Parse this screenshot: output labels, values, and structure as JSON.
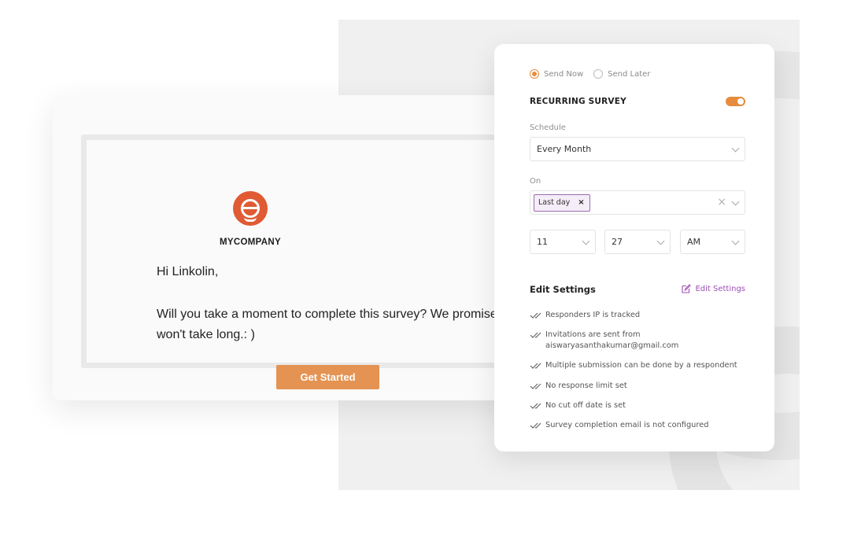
{
  "email": {
    "company": "MYCOMPANY",
    "greeting": "Hi Linkolin,",
    "message": "Will you take a moment to complete this survey? We promise it won't take long.: )",
    "cta_label": "Get Started"
  },
  "settings": {
    "send_options": [
      {
        "label": "Send Now",
        "selected": true
      },
      {
        "label": "Send Later",
        "selected": false
      }
    ],
    "recurring_title": "RECURRING SURVEY",
    "recurring_enabled": true,
    "schedule_label": "Schedule",
    "schedule_value": "Every Month",
    "on_label": "On",
    "on_chip": "Last day",
    "chip_remove": "×",
    "clear_all": "×",
    "hour": "11",
    "minute": "27",
    "ampm": "AM",
    "edit_title": "Edit Settings",
    "edit_link": "Edit Settings",
    "items": [
      {
        "line1": "Responders IP is tracked",
        "line2": ""
      },
      {
        "line1": "Invitations are sent from",
        "line2": "aiswaryasanthakumar@gmail.com"
      },
      {
        "line1": "Multiple submission can be done by a respondent",
        "line2": ""
      },
      {
        "line1": "No response limit set",
        "line2": ""
      },
      {
        "line1": "No cut off date is set",
        "line2": ""
      },
      {
        "line1": "Survey completion email is not configured",
        "line2": ""
      }
    ],
    "accent_color": "#e58c3d",
    "link_color": "#9d4fb6"
  }
}
